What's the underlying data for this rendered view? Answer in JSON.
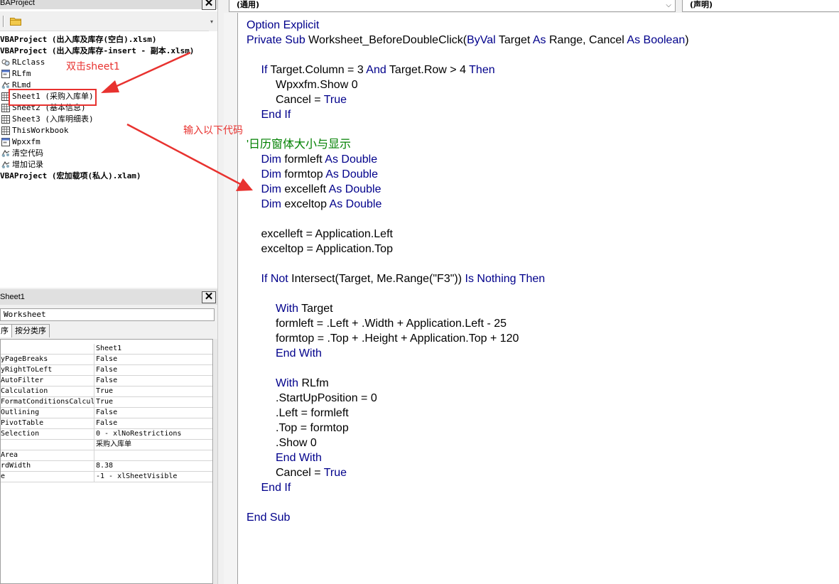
{
  "project": {
    "title": "VBAProject",
    "title_visible": "BAProject",
    "close_glyph": "✕",
    "items": [
      {
        "label": "VBAProject (出入库及库存(空白).xlsm)",
        "kind": "root"
      },
      {
        "label": "VBAProject (出入库及库存-insert - 副本.xlsm)",
        "kind": "root"
      },
      {
        "label": "RLclass",
        "kind": "class"
      },
      {
        "label": "RLfm",
        "kind": "form"
      },
      {
        "label": "RLmd",
        "kind": "module"
      },
      {
        "label": "Sheet1 (采购入库单)",
        "kind": "sheet"
      },
      {
        "label": "Sheet2 (基本信息)",
        "kind": "sheet"
      },
      {
        "label": "Sheet3 (入库明细表)",
        "kind": "sheet"
      },
      {
        "label": "ThisWorkbook",
        "kind": "sheet"
      },
      {
        "label": "Wpxxfm",
        "kind": "form"
      },
      {
        "label": "清空代码",
        "kind": "module"
      },
      {
        "label": "增加记录",
        "kind": "module"
      },
      {
        "label": "VBAProject (宏加载项(私人).xlam)",
        "kind": "root"
      }
    ]
  },
  "properties": {
    "title": "Sheet1",
    "object_value": "Worksheet",
    "tab_alpha": "序",
    "tab_categorized": "按分类序",
    "rows": [
      {
        "name": "",
        "value": "Sheet1"
      },
      {
        "name": "yPageBreaks",
        "value": "False"
      },
      {
        "name": "yRightToLeft",
        "value": "False"
      },
      {
        "name": "AutoFilter",
        "value": "False"
      },
      {
        "name": "Calculation",
        "value": "True"
      },
      {
        "name": "FormatConditionsCalcul:",
        "value": "True"
      },
      {
        "name": "Outlining",
        "value": "False"
      },
      {
        "name": "PivotTable",
        "value": "False"
      },
      {
        "name": "Selection",
        "value": "0 - xlNoRestrictions"
      },
      {
        "name": "",
        "value": "采购入库单"
      },
      {
        "name": "Area",
        "value": ""
      },
      {
        "name": "rdWidth",
        "value": "8.38"
      },
      {
        "name": "e",
        "value": "-1 - xlSheetVisible"
      }
    ]
  },
  "code_window": {
    "object_combo": "(通用)",
    "procedure_combo": "(声明)",
    "lines": [
      {
        "indent": 0,
        "tokens": [
          {
            "t": "Option Explicit",
            "c": "kw"
          }
        ]
      },
      {
        "indent": 0,
        "tokens": [
          {
            "t": "Private Sub ",
            "c": "kw"
          },
          {
            "t": "Worksheet_BeforeDoubleClick(",
            "c": ""
          },
          {
            "t": "ByVal",
            "c": "kw"
          },
          {
            "t": " Target ",
            "c": ""
          },
          {
            "t": "As",
            "c": "kw"
          },
          {
            "t": " Range, Cancel ",
            "c": ""
          },
          {
            "t": "As Boolean",
            "c": "kw"
          },
          {
            "t": ")",
            "c": ""
          }
        ]
      },
      {
        "indent": 0,
        "tokens": []
      },
      {
        "indent": 1,
        "tokens": [
          {
            "t": "If",
            "c": "kw"
          },
          {
            "t": " Target.Column = 3 ",
            "c": ""
          },
          {
            "t": "And",
            "c": "kw"
          },
          {
            "t": " Target.Row > 4 ",
            "c": ""
          },
          {
            "t": "Then",
            "c": "kw"
          }
        ]
      },
      {
        "indent": 2,
        "tokens": [
          {
            "t": "Wpxxfm.Show 0",
            "c": ""
          }
        ]
      },
      {
        "indent": 2,
        "tokens": [
          {
            "t": "Cancel = ",
            "c": ""
          },
          {
            "t": "True",
            "c": "kw"
          }
        ]
      },
      {
        "indent": 1,
        "tokens": [
          {
            "t": "End If",
            "c": "kw"
          }
        ]
      },
      {
        "indent": 0,
        "tokens": []
      },
      {
        "indent": 0,
        "tokens": [
          {
            "t": "'日历窗体大小与显示",
            "c": "cm"
          }
        ]
      },
      {
        "indent": 1,
        "tokens": [
          {
            "t": "Dim",
            "c": "kw"
          },
          {
            "t": " formleft ",
            "c": ""
          },
          {
            "t": "As Double",
            "c": "kw"
          }
        ]
      },
      {
        "indent": 1,
        "tokens": [
          {
            "t": "Dim",
            "c": "kw"
          },
          {
            "t": " formtop ",
            "c": ""
          },
          {
            "t": "As Double",
            "c": "kw"
          }
        ]
      },
      {
        "indent": 1,
        "tokens": [
          {
            "t": "Dim",
            "c": "kw"
          },
          {
            "t": " excelleft ",
            "c": ""
          },
          {
            "t": "As Double",
            "c": "kw"
          }
        ]
      },
      {
        "indent": 1,
        "tokens": [
          {
            "t": "Dim",
            "c": "kw"
          },
          {
            "t": " exceltop ",
            "c": ""
          },
          {
            "t": "As Double",
            "c": "kw"
          }
        ]
      },
      {
        "indent": 0,
        "tokens": []
      },
      {
        "indent": 1,
        "tokens": [
          {
            "t": "excelleft = Application.Left",
            "c": ""
          }
        ]
      },
      {
        "indent": 1,
        "tokens": [
          {
            "t": "exceltop = Application.Top",
            "c": ""
          }
        ]
      },
      {
        "indent": 0,
        "tokens": []
      },
      {
        "indent": 1,
        "tokens": [
          {
            "t": "If Not",
            "c": "kw"
          },
          {
            "t": " Intersect(Target, Me.Range(\"F3\")) ",
            "c": ""
          },
          {
            "t": "Is Nothing Then",
            "c": "kw"
          }
        ]
      },
      {
        "indent": 0,
        "tokens": []
      },
      {
        "indent": 2,
        "tokens": [
          {
            "t": "With",
            "c": "kw"
          },
          {
            "t": " Target",
            "c": ""
          }
        ]
      },
      {
        "indent": 2,
        "tokens": [
          {
            "t": "formleft = .Left + .Width + Application.Left - 25",
            "c": ""
          }
        ]
      },
      {
        "indent": 2,
        "tokens": [
          {
            "t": "formtop = .Top + .Height + Application.Top + 120",
            "c": ""
          }
        ]
      },
      {
        "indent": 2,
        "tokens": [
          {
            "t": "End With",
            "c": "kw"
          }
        ]
      },
      {
        "indent": 0,
        "tokens": []
      },
      {
        "indent": 2,
        "tokens": [
          {
            "t": "With",
            "c": "kw"
          },
          {
            "t": " RLfm",
            "c": ""
          }
        ]
      },
      {
        "indent": 2,
        "tokens": [
          {
            "t": ".StartUpPosition = 0",
            "c": ""
          }
        ]
      },
      {
        "indent": 2,
        "tokens": [
          {
            "t": ".Left = formleft",
            "c": ""
          }
        ]
      },
      {
        "indent": 2,
        "tokens": [
          {
            "t": ".Top = formtop",
            "c": ""
          }
        ]
      },
      {
        "indent": 2,
        "tokens": [
          {
            "t": ".Show 0",
            "c": ""
          }
        ]
      },
      {
        "indent": 2,
        "tokens": [
          {
            "t": "End With",
            "c": "kw"
          }
        ]
      },
      {
        "indent": 2,
        "tokens": [
          {
            "t": "Cancel = ",
            "c": ""
          },
          {
            "t": "True",
            "c": "kw"
          }
        ]
      },
      {
        "indent": 1,
        "tokens": [
          {
            "t": "End If",
            "c": "kw"
          }
        ]
      },
      {
        "indent": 0,
        "tokens": []
      },
      {
        "indent": 0,
        "tokens": [
          {
            "t": "End Sub",
            "c": "kw"
          }
        ]
      }
    ]
  },
  "annotations": {
    "double_click_hint": "双击sheet1",
    "enter_code_hint": "输入以下代码"
  },
  "colors": {
    "keyword": "#00008b",
    "comment": "#008000",
    "annotation": "#e8322f"
  }
}
